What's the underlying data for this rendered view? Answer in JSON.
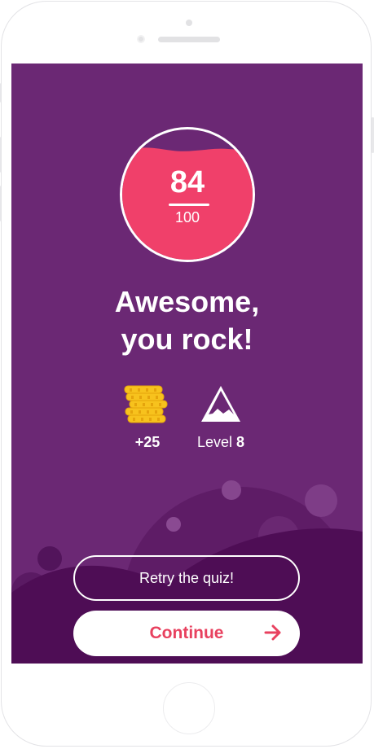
{
  "result": {
    "score": "84",
    "max_score": "100"
  },
  "headline": {
    "line1": "Awesome,",
    "line2": "you rock!"
  },
  "rewards": {
    "coins": "+25",
    "level_prefix": "Level",
    "level_number": "8"
  },
  "actions": {
    "retry_label": "Retry the quiz!",
    "continue_label": "Continue"
  },
  "colors": {
    "background": "#6b2874",
    "dark_wave": "#4e0d55",
    "score_fill": "#f0406a",
    "accent": "#e8415f",
    "coin": "#f7c21d"
  },
  "icons": [
    "coins-icon",
    "mountain-icon",
    "arrow-right-icon"
  ]
}
